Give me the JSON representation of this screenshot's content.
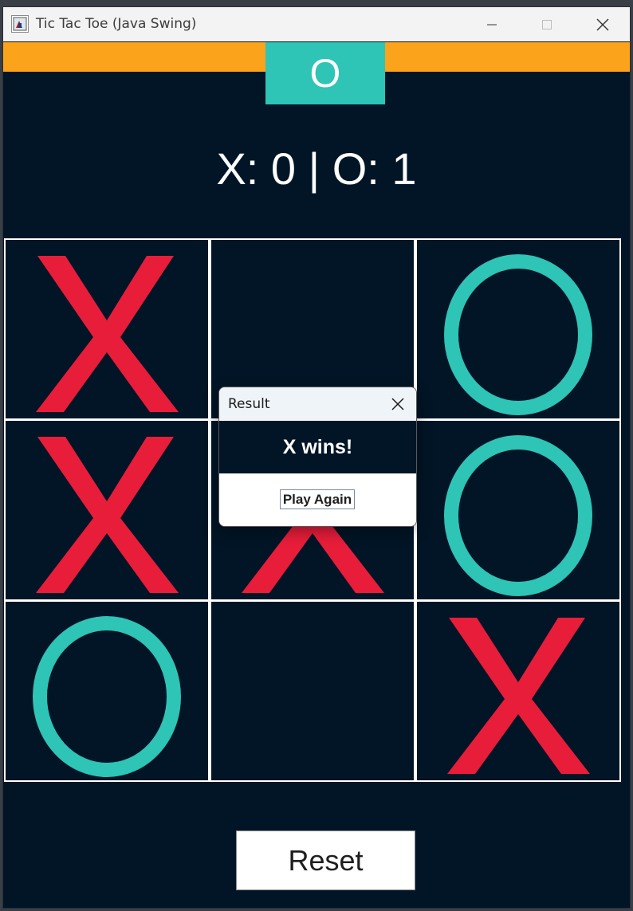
{
  "window": {
    "title": "Tic Tac Toe (Java Swing)"
  },
  "turn_indicator": {
    "symbol": "O"
  },
  "scoreboard": {
    "text": "X: 0 | O: 1"
  },
  "board": {
    "cells": [
      "X",
      "",
      "O",
      "X",
      "X",
      "O",
      "O",
      "",
      "X"
    ]
  },
  "dialog": {
    "title": "Result",
    "message": "X wins!",
    "button_label": "Play Again"
  },
  "controls": {
    "reset_label": "Reset"
  },
  "colors": {
    "x": "#e81d3a",
    "o": "#2ec4b6",
    "background": "#011526",
    "accent": "#fca31c"
  }
}
